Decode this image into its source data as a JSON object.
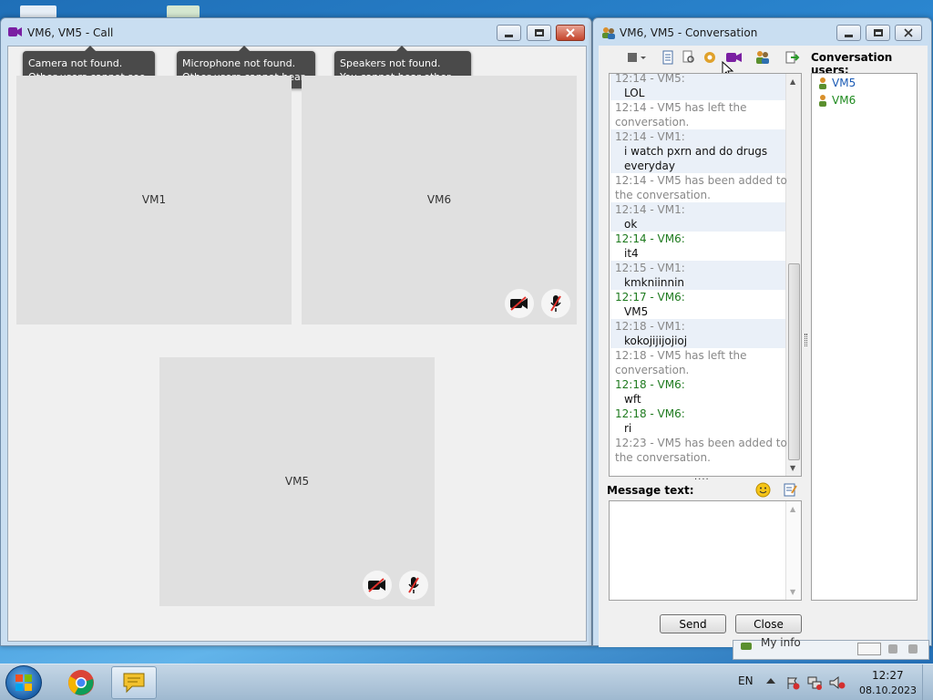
{
  "call_window": {
    "title": "VM6, VM5 - Call",
    "tooltips": [
      {
        "line1": "Camera not found.",
        "line2": "Other users cannot see you."
      },
      {
        "line1": "Microphone not found.",
        "line2": "Other users cannot hear you."
      },
      {
        "line1": "Speakers not found.",
        "line2": "You cannot hear other users."
      }
    ],
    "tiles": [
      {
        "label": "VM1"
      },
      {
        "label": "VM6"
      },
      {
        "label": "VM5"
      }
    ]
  },
  "conversation_window": {
    "title": "VM6, VM5 - Conversation",
    "users_label": "Conversation users:",
    "users": [
      {
        "name": "VM5"
      },
      {
        "name": "VM6"
      }
    ],
    "messages": [
      {
        "kind": "meta-vm1",
        "text": "12:14 - VM5:"
      },
      {
        "kind": "body",
        "text": "LOL"
      },
      {
        "kind": "sys",
        "text": "12:14 - VM5 has left the"
      },
      {
        "kind": "sys",
        "text": "conversation."
      },
      {
        "kind": "meta-vm1",
        "text": "12:14 - VM1:"
      },
      {
        "kind": "body",
        "text": "i watch pxrn and do drugs"
      },
      {
        "kind": "body",
        "text": "everyday"
      },
      {
        "kind": "sys",
        "text": "12:14 - VM5 has been added to"
      },
      {
        "kind": "sys",
        "text": "the conversation."
      },
      {
        "kind": "meta-vm1",
        "text": "12:14 - VM1:"
      },
      {
        "kind": "body",
        "text": "ok"
      },
      {
        "kind": "meta-vm6",
        "text": "12:14 - VM6:"
      },
      {
        "kind": "body",
        "text": "it4"
      },
      {
        "kind": "meta-vm1",
        "text": "12:15 - VM1:"
      },
      {
        "kind": "body",
        "text": "kmkniinnin"
      },
      {
        "kind": "meta-vm6",
        "text": "12:17 - VM6:"
      },
      {
        "kind": "body",
        "text": "VM5"
      },
      {
        "kind": "meta-vm1",
        "text": "12:18 - VM1:"
      },
      {
        "kind": "body",
        "text": "kokojijijojioj"
      },
      {
        "kind": "sys",
        "text": "12:18 - VM5 has left the"
      },
      {
        "kind": "sys",
        "text": "conversation."
      },
      {
        "kind": "meta-vm6",
        "text": "12:18 - VM6:"
      },
      {
        "kind": "body",
        "text": "wft"
      },
      {
        "kind": "meta-vm6",
        "text": "12:18 - VM6:"
      },
      {
        "kind": "body",
        "text": "ri"
      },
      {
        "kind": "sys",
        "text": "12:23 - VM5 has been added to"
      },
      {
        "kind": "sys",
        "text": "the conversation."
      }
    ],
    "message_label": "Message text:",
    "message_value": "",
    "send_label": "Send",
    "close_label": "Close",
    "grip": "...."
  },
  "my_info": {
    "label": "My info"
  },
  "taskbar": {
    "language": "EN",
    "time": "12:27",
    "date": "08.10.2023"
  },
  "colors": {
    "vm6_green": "#1e7a1e",
    "system_gray": "#888888",
    "user_blue": "#1b5bb5"
  }
}
